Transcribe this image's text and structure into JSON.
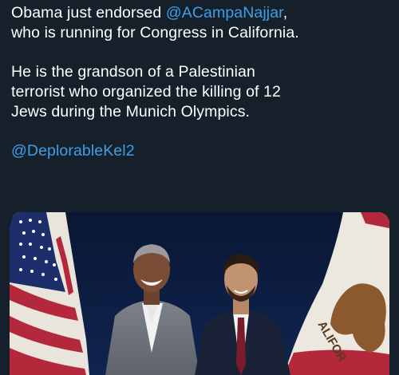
{
  "tweet": {
    "line1_prefix": "Obama just endorsed ",
    "line1_mention": "@ACampaNajjar",
    "line1_suffix": ",",
    "line2": "who is running for Congress in California.",
    "para2_line1": "He is the grandson of a Palestinian",
    "para2_line2": "terrorist who organized the killing of 12",
    "para2_line3": "Jews during the Munich Olympics.",
    "signature": "@DeplorableKel2"
  },
  "media": {
    "description_icon": "photo",
    "flag_text": "ALIFOR"
  },
  "colors": {
    "background": "#15202b",
    "text": "#ffffff",
    "mention": "#3e9fe8"
  }
}
